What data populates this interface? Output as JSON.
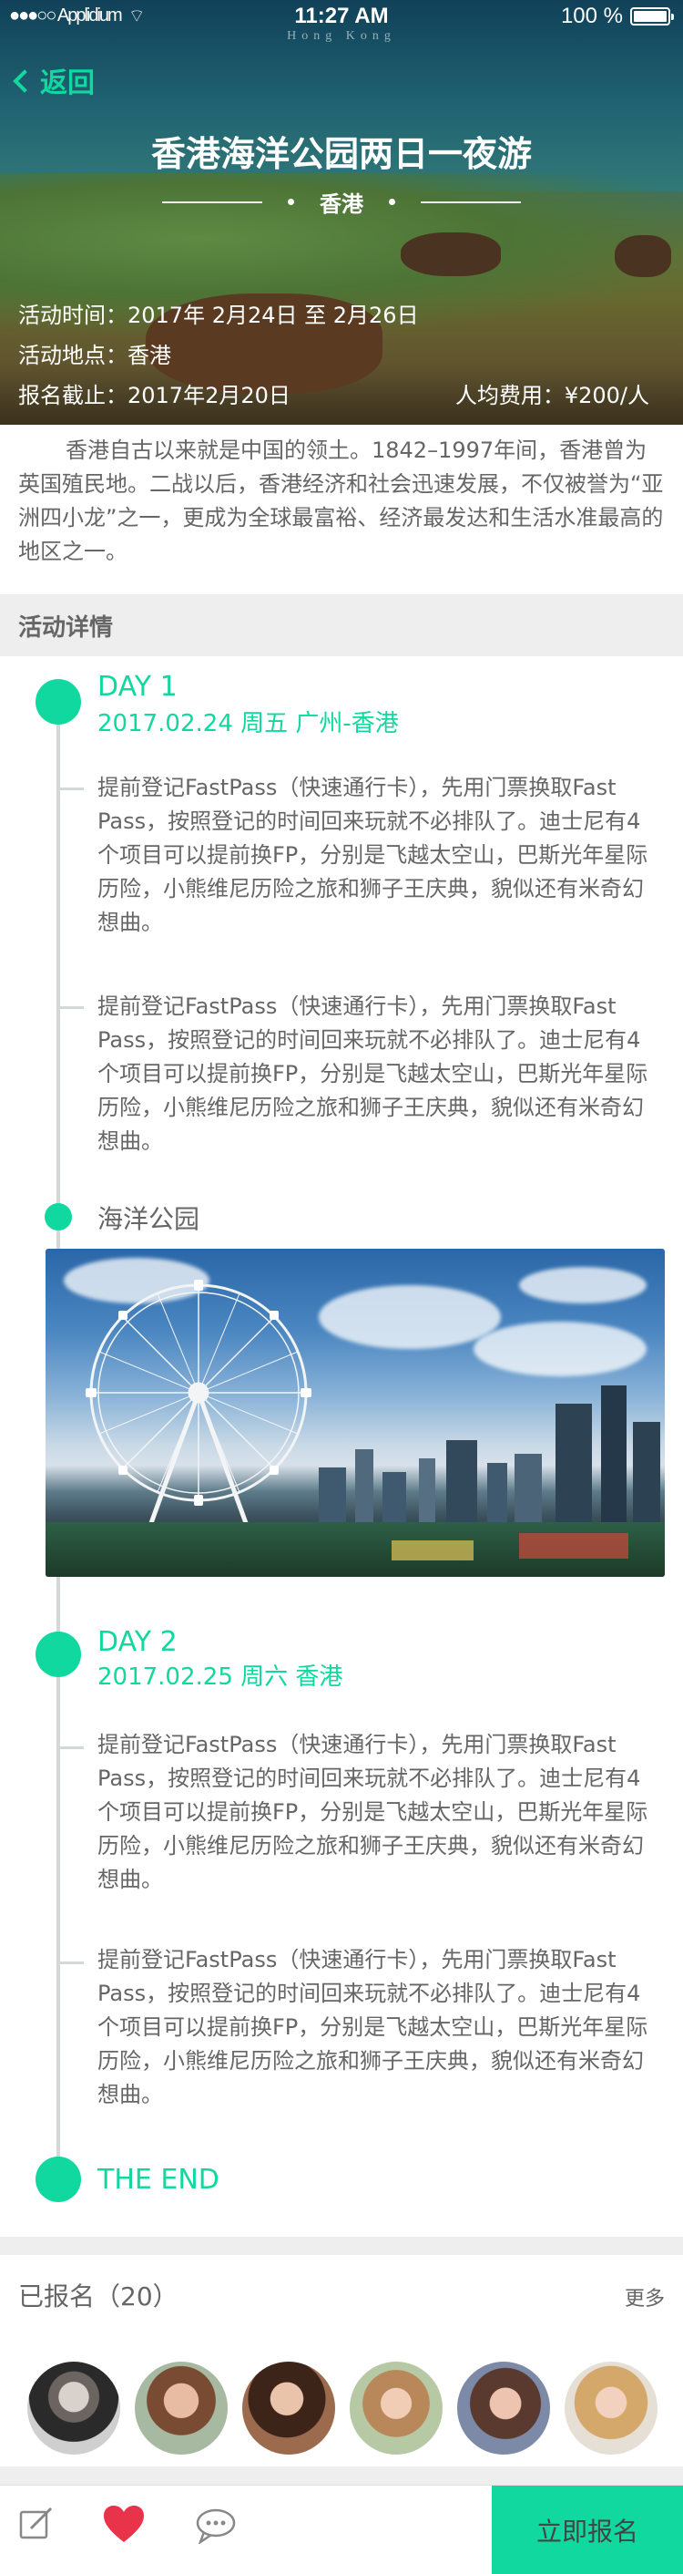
{
  "status_bar": {
    "carrier": "●●●○○ Applidium",
    "time": "11:27 AM",
    "battery": "100 %"
  },
  "hero": {
    "subtitle_en": "Hong Kong",
    "back_label": "返回",
    "title": "香港海洋公园两日一夜游",
    "city": "香港",
    "time_line": "活动时间：2017年 2月24日 至 2月26日",
    "place_line": "活动地点：香港",
    "deadline_line": "报名截止：2017年2月20日",
    "price_line": "人均费用：¥200/人"
  },
  "intro": "香港自古以来就是中国的领土。1842–1997年间，香港曾为英国殖民地。二战以后，香港经济和社会迅速发展，不仅被誉为“亚洲四小龙”之一，更成为全球最富裕、经济最发达和生活水准最高的地区之一。",
  "section_title": "活动详情",
  "timeline": {
    "day1": {
      "label": "DAY 1",
      "sub": "2017.02.24   周五   广州-香港"
    },
    "day1_para1": "提前登记FastPass（快速通行卡），先用门票换取Fast Pass，按照登记的时间回来玩就不必排队了。迪士尼有4个项目可以提前换FP，分别是飞越太空山，巴斯光年星际历险，小熊维尼历险之旅和狮子王庆典，貌似还有米奇幻想曲。",
    "day1_para2": "提前登记FastPass（快速通行卡），先用门票换取Fast Pass，按照登记的时间回来玩就不必排队了。迪士尼有4个项目可以提前换FP，分别是飞越太空山，巴斯光年星际历险，小熊维尼历险之旅和狮子王庆典，貌似还有米奇幻想曲。",
    "place": "海洋公园",
    "day2": {
      "label": "DAY 2",
      "sub": "2017.02.25   周六   香港"
    },
    "day2_para1": "提前登记FastPass（快速通行卡），先用门票换取Fast Pass，按照登记的时间回来玩就不必排队了。迪士尼有4个项目可以提前换FP，分别是飞越太空山，巴斯光年星际历险，小熊维尼历险之旅和狮子王庆典，貌似还有米奇幻想曲。",
    "day2_para2": "提前登记FastPass（快速通行卡），先用门票换取Fast Pass，按照登记的时间回来玩就不必排队了。迪士尼有4个项目可以提前换FP，分别是飞越太空山，巴斯光年星际历险，小熊维尼历险之旅和狮子王庆典，貌似还有米奇幻想曲。",
    "end": "THE END"
  },
  "signed": {
    "title": "已报名（20）",
    "more": "更多"
  },
  "footer": {
    "signup": "立即报名"
  },
  "colors": {
    "accent": "#10D89F",
    "text": "#666666",
    "line": "#D3D8D9",
    "button_text": "#444444",
    "heart": "#e8334a"
  },
  "icons": [
    "back-chevron-icon",
    "wifi-icon",
    "battery-icon",
    "edit-icon",
    "heart-icon",
    "chat-icon"
  ]
}
